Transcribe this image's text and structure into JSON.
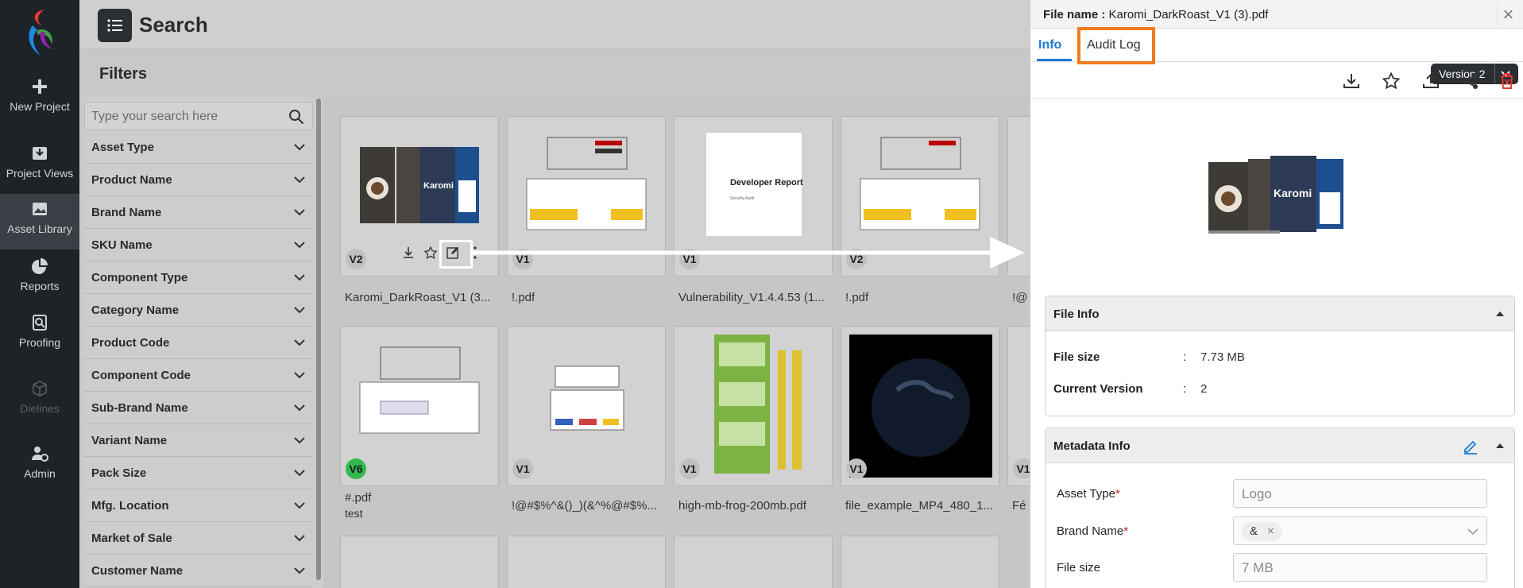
{
  "nav": {
    "items": [
      {
        "label": "New Project",
        "icon": "plus-icon"
      },
      {
        "label": "Project Views",
        "icon": "inbox-icon"
      },
      {
        "label": "Asset Library",
        "icon": "image-icon"
      },
      {
        "label": "Reports",
        "icon": "pie-chart-icon"
      },
      {
        "label": "Proofing",
        "icon": "search-doc-icon"
      },
      {
        "label": "Dielines",
        "icon": "box-icon"
      },
      {
        "label": "Admin",
        "icon": "user-settings-icon"
      }
    ]
  },
  "header": {
    "title": "Search"
  },
  "filters": {
    "title": "Filters",
    "search_placeholder": "Type your search here",
    "items": [
      "Asset Type",
      "Product Name",
      "Brand Name",
      "SKU Name",
      "Component Type",
      "Category Name",
      "Product Code",
      "Component Code",
      "Sub-Brand Name",
      "Variant Name",
      "Pack Size",
      "Mfg. Location",
      "Market of Sale",
      "Customer Name"
    ]
  },
  "grid": {
    "cards": [
      {
        "version": "V2",
        "name": "Karomi_DarkRoast_V1 (3..."
      },
      {
        "version": "V1",
        "name": "!.pdf"
      },
      {
        "version": "V1",
        "name": "Vulnerability_V1.4.4.53 (1..."
      },
      {
        "version": "V2",
        "name": "!.pdf"
      },
      {
        "version": "",
        "name": "!@"
      },
      {
        "version": "V6",
        "name": "#.pdf",
        "sub": "test"
      },
      {
        "version": "V1",
        "name": "!@#$%^&()_)(&^%@#$%..."
      },
      {
        "version": "V1",
        "name": "high-mb-frog-200mb.pdf"
      },
      {
        "version": "V1",
        "name": "file_example_MP4_480_1..."
      },
      {
        "version": "V1",
        "name": "Fé"
      }
    ],
    "report_title": "Developer Report",
    "report_sub": "Security Audit"
  },
  "panel": {
    "file_name_label": "File name : ",
    "file_name": "Karomi_DarkRoast_V1 (3).pdf",
    "tabs": [
      "Info",
      "Audit Log"
    ],
    "version": "Version 2",
    "file_info": {
      "title": "File Info",
      "rows": [
        {
          "key": "File size",
          "value": "7.73 MB"
        },
        {
          "key": "Current Version",
          "value": "2"
        }
      ]
    },
    "metadata": {
      "title": "Metadata Info",
      "fields": [
        {
          "label": "Asset Type",
          "required": true,
          "value": "Logo"
        },
        {
          "label": "Brand Name",
          "required": true,
          "value": "&"
        },
        {
          "label": "File size",
          "required": false,
          "value": "7 MB"
        }
      ]
    },
    "preview_brand": "Karomi"
  },
  "colors": {
    "accent": "#1e7ad8",
    "highlight": "#f07a1e",
    "badge_green": "#31b94d",
    "delete": "#e53935"
  }
}
